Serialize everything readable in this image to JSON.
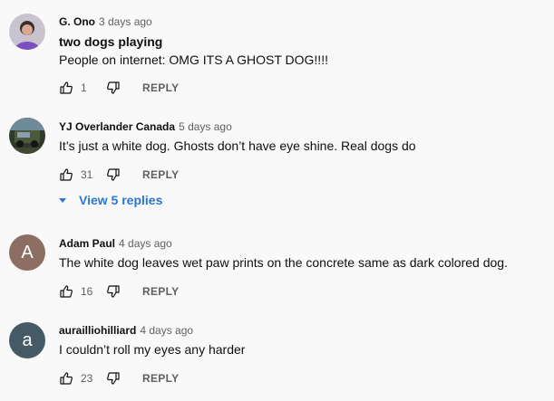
{
  "comments": [
    {
      "author": "G. Ono",
      "time": "3 days ago",
      "title": "two dogs playing",
      "text": "People on internet: OMG ITS A GHOST DOG!!!!",
      "likes": "1",
      "reply": "REPLY"
    },
    {
      "author": "YJ Overlander Canada",
      "time": "5 days ago",
      "text": "It’s just a white dog. Ghosts don’t have eye shine. Real dogs do",
      "likes": "31",
      "reply": "REPLY",
      "replies_link": "View 5 replies"
    },
    {
      "author": "Adam Paul",
      "time": "4 days ago",
      "avatar_letter": "A",
      "avatar_color": "#8d6e63",
      "text": "The white dog leaves wet paw prints on the concrete same as dark colored dog.",
      "likes": "16",
      "reply": "REPLY"
    },
    {
      "author": "aurailliohilliard",
      "time": "4 days ago",
      "avatar_letter": "a",
      "avatar_color": "#455a64",
      "text": "I couldn’t roll my eyes any harder",
      "likes": "23",
      "reply": "REPLY"
    }
  ],
  "icons": {
    "like": "thumb-up-icon",
    "dislike": "thumb-down-icon",
    "expand": "caret-down-icon"
  }
}
